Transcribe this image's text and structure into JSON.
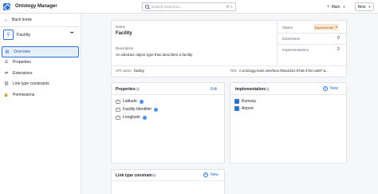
{
  "topbar": {
    "app_title": "Ontology Manager",
    "search_placeholder": "Search resources...",
    "search_shortcut": "⌘ K",
    "branch": "Main",
    "new_label": "New"
  },
  "sidebar": {
    "back_label": "Back home",
    "object_name": "Facility",
    "items": [
      {
        "label": "Overview",
        "icon": "overview-icon",
        "active": true
      },
      {
        "label": "Properties",
        "icon": "properties-icon",
        "active": false
      },
      {
        "label": "Extensions",
        "icon": "extensions-icon",
        "active": false
      },
      {
        "label": "Link type constraints",
        "icon": "link-icon",
        "active": false
      },
      {
        "label": "Permissions",
        "icon": "lock-icon",
        "active": false
      }
    ]
  },
  "overview": {
    "name_label": "Name",
    "name_value": "Facility",
    "description_label": "Description",
    "description_value": "An abstract object type that describes a facility",
    "api_label": "API name",
    "api_value": "facility",
    "rid_label": "RID",
    "rid_value": "ri.ontology.main.interface.f82e4d12-97a6-47bc-a397-a..."
  },
  "stats": {
    "status_label": "Status",
    "status_value": "Experimental",
    "extensions_label": "Extensions",
    "extensions_value": "0",
    "implementations_label": "Implementations",
    "implementations_value": "2"
  },
  "properties": {
    "title": "Properties",
    "count": "3",
    "edit_label": "Edit",
    "items": [
      "Latitude",
      "Facility Identifier",
      "Longitude"
    ]
  },
  "implementations": {
    "title": "Implementations",
    "count": "2",
    "new_label": "New",
    "items": [
      "Runway",
      "Airport"
    ]
  },
  "link_constraints": {
    "title": "Link type constraints",
    "count": "0",
    "new_label": "New"
  },
  "colors": {
    "accent": "#2d72d2",
    "badge_bg": "#fbe8d4",
    "badge_text": "#935610"
  }
}
